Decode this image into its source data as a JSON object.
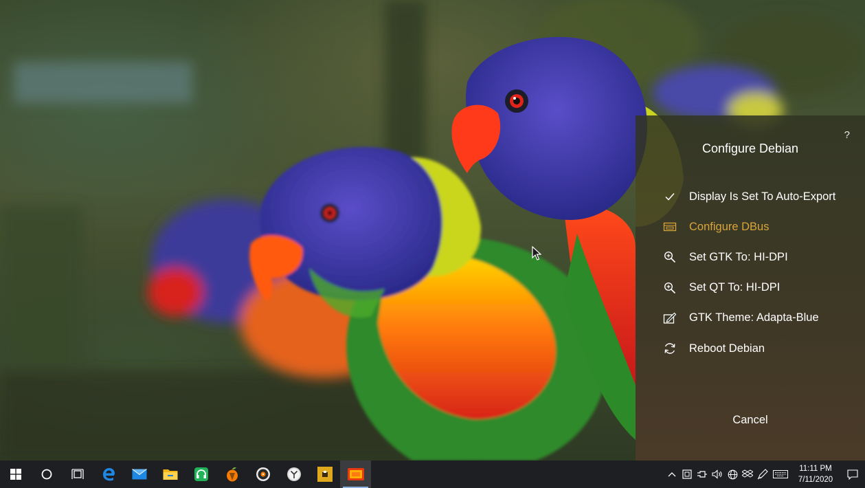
{
  "wallpaper": {
    "name": "rainbow-lorikeets"
  },
  "dialog": {
    "help_label": "?",
    "title": "Configure Debian",
    "items": [
      {
        "icon": "checkmark-icon",
        "label": "Display Is Set To Auto-Export",
        "highlighted": false
      },
      {
        "icon": "bus-icon",
        "label": "Configure DBus",
        "highlighted": true
      },
      {
        "icon": "zoom-in-icon",
        "label": "Set GTK To: HI-DPI",
        "highlighted": false
      },
      {
        "icon": "zoom-in-icon",
        "label": "Set QT To: HI-DPI",
        "highlighted": false
      },
      {
        "icon": "theme-edit-icon",
        "label": "GTK Theme: Adapta-Blue",
        "highlighted": false
      },
      {
        "icon": "refresh-icon",
        "label": "Reboot Debian",
        "highlighted": false
      }
    ],
    "cancel_label": "Cancel",
    "highlight_color": "#d9a53a"
  },
  "taskbar": {
    "apps": [
      {
        "name": "start-button",
        "icon": "windows-logo-icon"
      },
      {
        "name": "search-button",
        "icon": "cortana-circle-icon"
      },
      {
        "name": "task-view-button",
        "icon": "task-view-icon"
      },
      {
        "name": "edge-app",
        "icon": "edge-icon"
      },
      {
        "name": "mail-app",
        "icon": "mail-icon"
      },
      {
        "name": "file-explorer-app",
        "icon": "folder-icon"
      },
      {
        "name": "headphones-app",
        "icon": "headphones-icon"
      },
      {
        "name": "fl-studio-app",
        "icon": "fruity-icon"
      },
      {
        "name": "disc-app",
        "icon": "disc-icon"
      },
      {
        "name": "clock-app",
        "icon": "clock-icon"
      },
      {
        "name": "note-app",
        "icon": "note-icon"
      },
      {
        "name": "x-server-app",
        "icon": "x-server-icon",
        "active": true
      }
    ],
    "tray": {
      "icons": [
        "chevron-up-icon",
        "tablet-icon",
        "power-plug-icon",
        "volume-icon",
        "globe-icon",
        "dropbox-icon",
        "pen-icon",
        "keyboard-icon"
      ],
      "time": "11:11 PM",
      "date": "7/11/2020"
    },
    "accent_color": "#8fb4e0"
  }
}
